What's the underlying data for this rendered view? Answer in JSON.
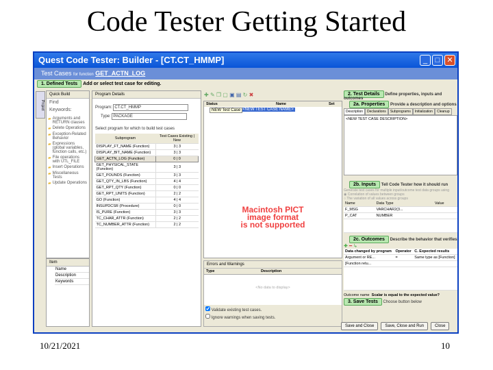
{
  "slide": {
    "title": "Code Tester Getting Started",
    "date": "10/21/2021",
    "page": "10"
  },
  "window": {
    "title": "Quest Code Tester: Builder - [CT.CT_HMMP]",
    "subtitle": "Test Cases",
    "subtitle_small": "for function",
    "function": "GET_ACTN_LOG"
  },
  "step1": {
    "label": "1. Defined Tests",
    "desc": "Add or select test case for editing."
  },
  "left": {
    "tab": "Project",
    "quick_build": "Quick Build",
    "find": "Find",
    "keywords": "Keywords:",
    "items": [
      "Arguments and RETURN clauses",
      "Delete Operations",
      "Exception-Related Behavior",
      "Expressions (global variables, function calls, etc.)",
      "File operations with UTL_FILE",
      "Insert Operations",
      "Miscellaneous Tests",
      "Update Operations"
    ],
    "item_header": "Item",
    "item_fields": [
      "Name",
      "Description",
      "Keywords"
    ]
  },
  "program": {
    "header": "Program Details",
    "program_label": "Program:",
    "program_value": "CT.CT_HMMP",
    "type_label": "Type:",
    "type_value": "PACKAGE",
    "select_label": "Select program for which to build test cases",
    "col_sub": "Subprogram",
    "col_cases": "Test Cases Existing | New",
    "rows": [
      [
        "DISPLAY_FT_NAME (Function)",
        "3 | 3"
      ],
      [
        "DISPLAY_BIT_NAME (Function)",
        "3 | 3"
      ],
      [
        "GET_ACTN_LOG (Function)",
        "0 | 0"
      ],
      [
        "GET_PHYSICAL_STATE (Function)",
        "3 | 3"
      ],
      [
        "GET_POUNDS (Function)",
        "3 | 3"
      ],
      [
        "GET_QTY_IN_LBS (Function)",
        "4 | 4"
      ],
      [
        "GET_RPT_QTY (Function)",
        "0 | 0"
      ],
      [
        "GET_RPT_UNITS (Function)",
        "2 | 2"
      ],
      [
        "GO (Function)",
        "4 | 4"
      ],
      [
        "INSUPDCSR (Procedure)",
        "0 | 0"
      ],
      [
        "IS_PURE (Function)",
        "3 | 3"
      ],
      [
        "TC_CHAR_ATTR (Function)",
        "2 | 2"
      ],
      [
        "TC_NUMBER_ATTR (Function)",
        "2 | 2"
      ]
    ]
  },
  "middle": {
    "col_status": "Status",
    "col_name": "Name",
    "col_set": "Set",
    "tooltip": "NEW Test Case",
    "row_name": "<NEW TEST CASE NAME>",
    "pict": [
      "Macintosh PICT",
      "image format",
      "is not supported"
    ],
    "errors_header": "Errors and Warnings",
    "col_type": "Type",
    "col_desc": "Description",
    "empty": "<No data to display>",
    "chk1": "Validate existing test cases.",
    "chk2": "Ignore warnings when saving tests."
  },
  "right": {
    "step2": "2. Test Details",
    "step2_desc": "Define properties, inputs and outcomes",
    "step2a": "2a. Properties",
    "step2a_desc": "Provide a description and options",
    "tabs": [
      "Description",
      "Declarations",
      "Subprograms",
      "Initialization",
      "Cleanup"
    ],
    "desc_text": "<NEW TEST CASE DESCRIPTION>",
    "step2b": "2b. Inputs",
    "step2b_desc": "Tell Code Tester how it should run",
    "gen_text": "Generate test cases for multiple input/outcome test data groups using",
    "radio1": "Correlation of values between groups",
    "radio2": "The variation of all values across groups",
    "in_cols": [
      "Name",
      "Data Type",
      "Value"
    ],
    "inputs": [
      [
        "F_MSG",
        "VARCHAR2(3..."
      ],
      [
        "P_CAT",
        "NUMBER"
      ]
    ],
    "step2c": "2c. Outcomes",
    "step2c_desc": "Describe the behavior that verifies",
    "out_cols": [
      "Data changed by program",
      "Operator",
      "C. Expected results"
    ],
    "out_row1": [
      "Argument or RE...",
      "=",
      "Same type as [Function]"
    ],
    "out_row2": "[Function retu...",
    "outcome_label": "Outcome name",
    "outcome_value": "Scalar is equal to the expected value?",
    "step3": "3. Save Tests",
    "step3_desc": "Choose button below",
    "buttons": [
      "Save and Close",
      "Save, Close and Run",
      "Close"
    ]
  }
}
